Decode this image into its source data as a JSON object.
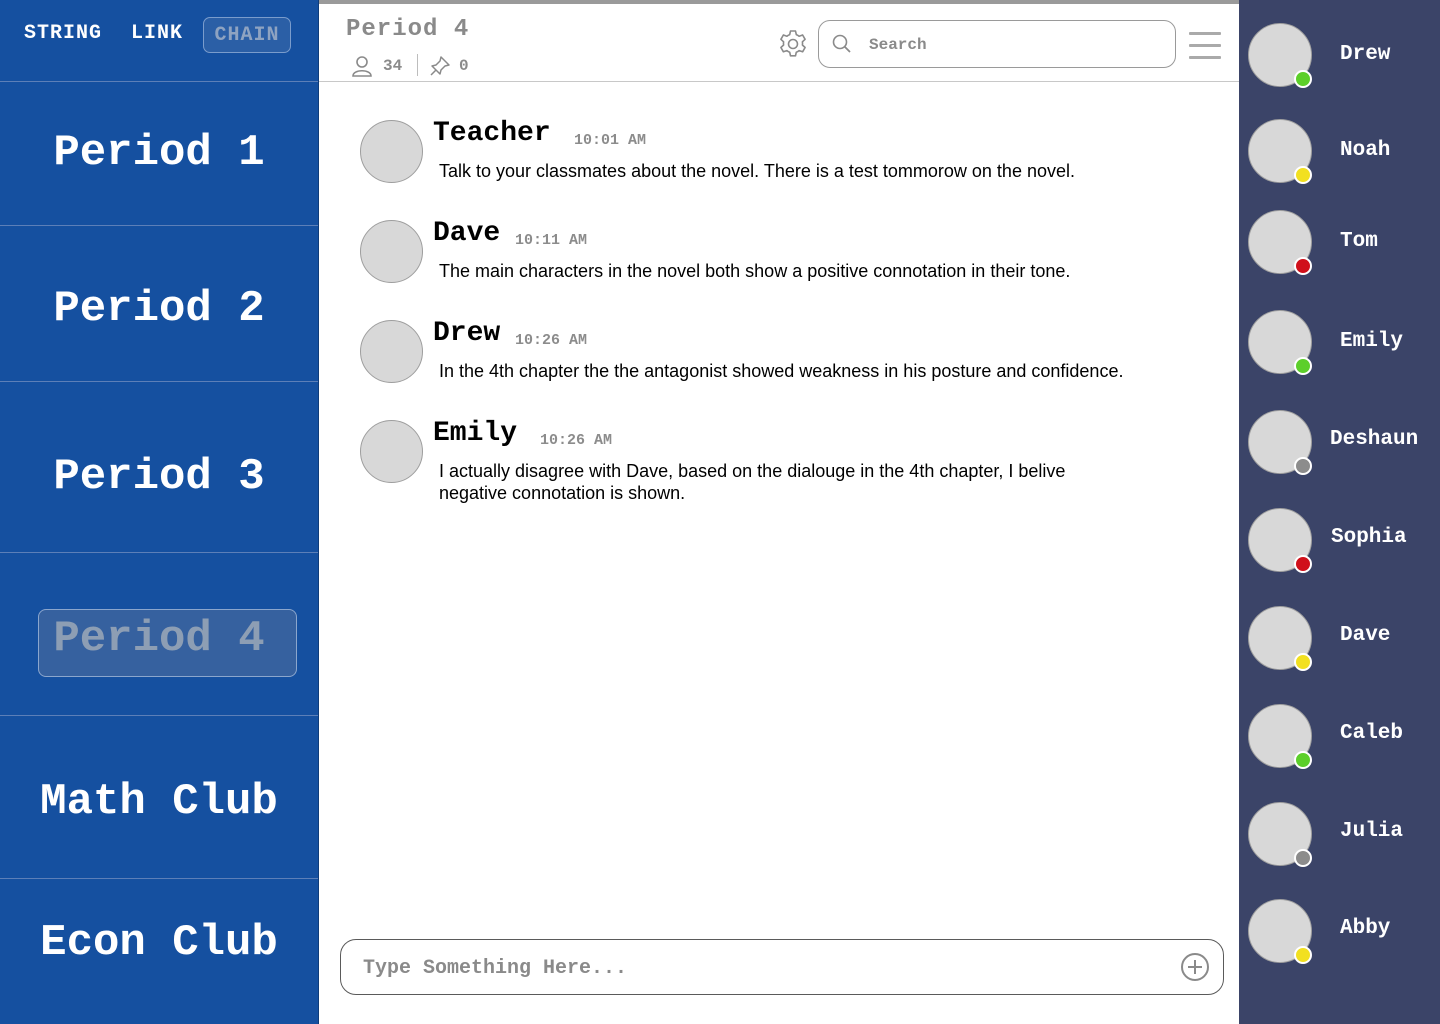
{
  "brand": {
    "word1": "STRING",
    "word2": "LINK",
    "word3": "CHAIN"
  },
  "channels": [
    {
      "label": "Period 1",
      "active": false
    },
    {
      "label": "Period 2",
      "active": false
    },
    {
      "label": "Period 3",
      "active": false
    },
    {
      "label": "Period 4",
      "active": true
    },
    {
      "label": "Math Club",
      "active": false
    },
    {
      "label": "Econ Club",
      "active": false
    }
  ],
  "header": {
    "title": "Period 4",
    "member_count": "34",
    "pinned_count": "0",
    "search_placeholder": "Search"
  },
  "messages": [
    {
      "author": "Teacher",
      "time": "10:01 AM",
      "text": "Talk to your classmates about the novel. There is a test tommorow on the novel."
    },
    {
      "author": "Dave",
      "time": "10:11 AM",
      "text": "The main characters in the novel both show a positive connotation in their tone."
    },
    {
      "author": "Drew",
      "time": "10:26 AM",
      "text": "In the 4th chapter the the antagonist showed weakness in his posture and confidence."
    },
    {
      "author": "Emily",
      "time": "10:26 AM",
      "text": "I actually disagree with Dave, based on the dialouge in the 4th chapter, I belive negative connotation is shown."
    }
  ],
  "composer": {
    "placeholder": "Type Something Here..."
  },
  "members": [
    {
      "name": "Drew",
      "status": "online"
    },
    {
      "name": "Noah",
      "status": "away"
    },
    {
      "name": "Tom",
      "status": "busy"
    },
    {
      "name": "Emily",
      "status": "online"
    },
    {
      "name": "Deshaun",
      "status": "offline"
    },
    {
      "name": "Sophia",
      "status": "busy"
    },
    {
      "name": "Dave",
      "status": "away"
    },
    {
      "name": "Caleb",
      "status": "online"
    },
    {
      "name": "Julia",
      "status": "offline"
    },
    {
      "name": "Abby",
      "status": "away"
    }
  ],
  "colors": {
    "sidebar": "#1550a0",
    "members_panel": "#3b4468",
    "online": "#5ccf2a",
    "away": "#f2e020",
    "busy": "#d0101a",
    "offline": "#8c8c8c"
  }
}
